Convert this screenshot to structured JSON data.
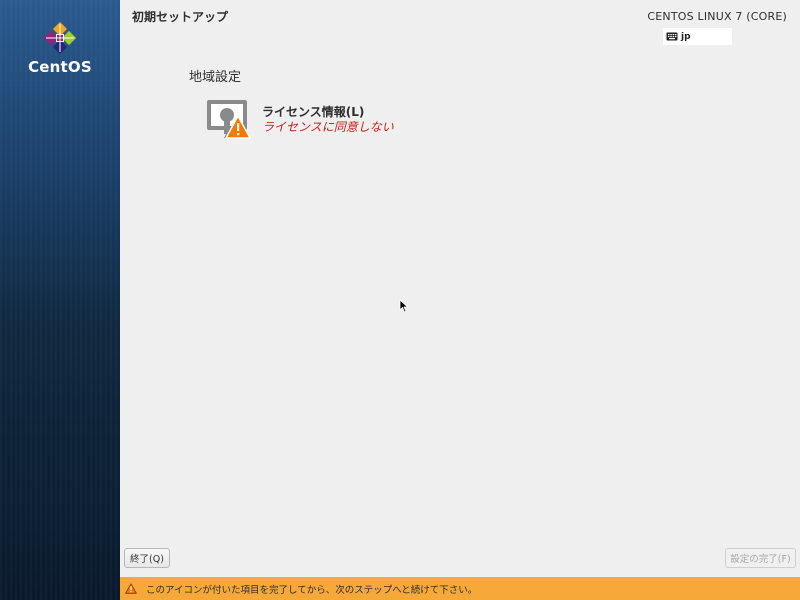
{
  "sidebar": {
    "logo_text": "CentOS",
    "logo_icon": "centos-logo-icon"
  },
  "header": {
    "title": "初期セットアップ",
    "product": "CENTOS LINUX 7 (CORE)",
    "keyboard_layout": "jp",
    "keyboard_icon": "keyboard-icon"
  },
  "main": {
    "category": "地域設定",
    "spokes": [
      {
        "name": "ライセンス情報(L)",
        "status": "ライセンスに同意しない",
        "icon": "license-warning-icon"
      }
    ]
  },
  "footer": {
    "quit_label": "終了(Q)",
    "finish_label": "設定の完了(F)",
    "warning_text": "このアイコンが付いた項目を完了してから、次のステップへと続けて下さい。",
    "warning_icon": "warning-icon"
  },
  "colors": {
    "sidebar_top": "#2a5a8f",
    "sidebar_bottom": "#0a1a2c",
    "warning_bar": "#f6a938",
    "status_error": "#c8201a",
    "background": "#efefef"
  }
}
